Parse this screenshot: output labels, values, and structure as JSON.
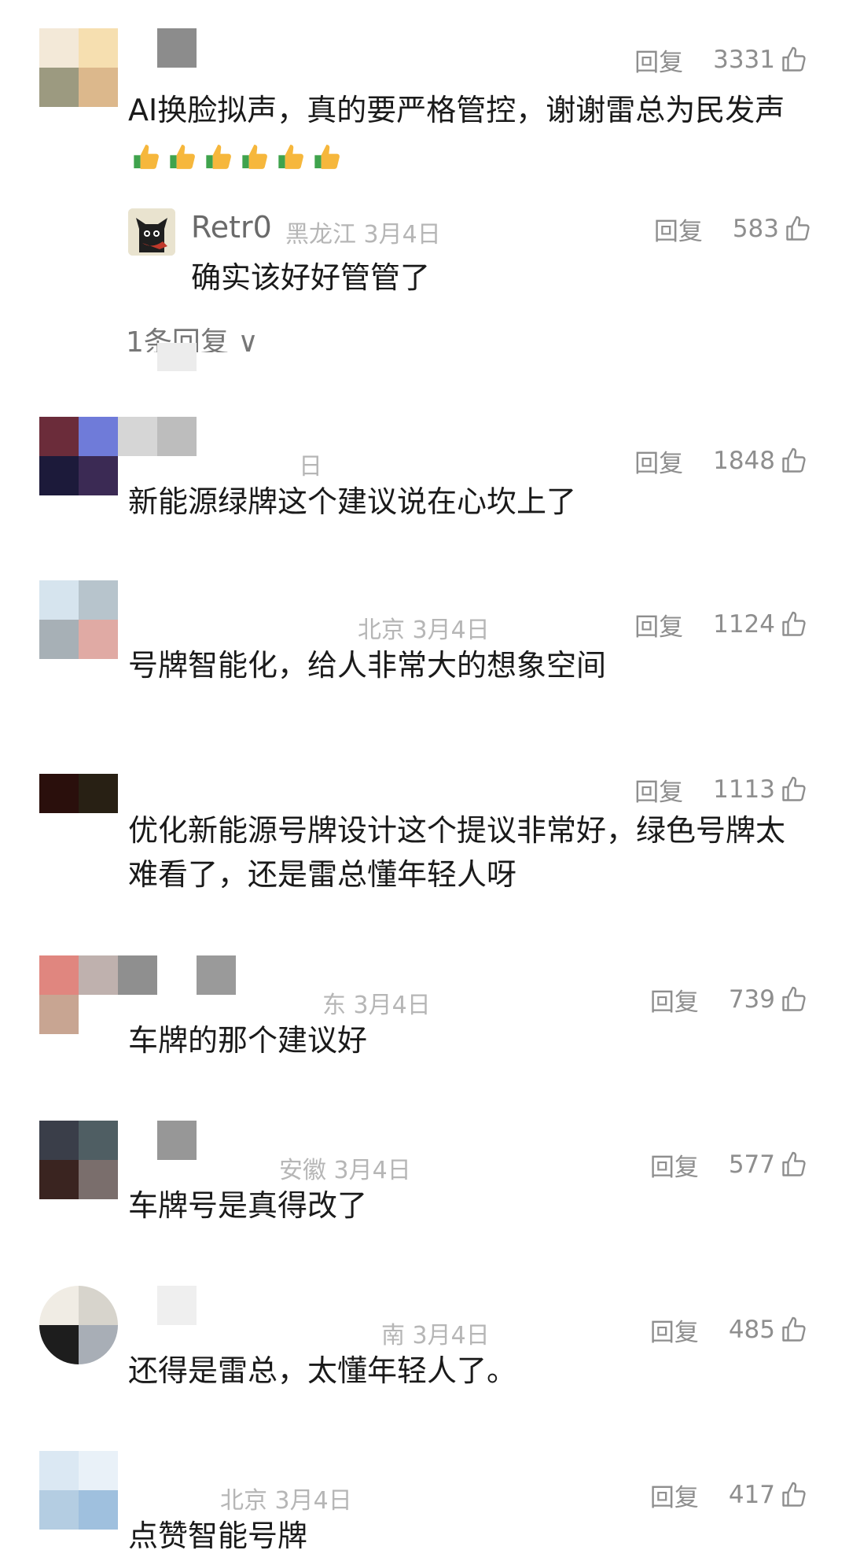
{
  "reply_label": "回复",
  "comments": [
    {
      "meta": "",
      "likes": "3331",
      "text": "AI换脸拟声，真的要严格管控，谢谢雷总为民发声",
      "emoji_count": 6
    },
    {
      "meta": "日",
      "likes": "1848",
      "text": "新能源绿牌这个建议说在心坎上了"
    },
    {
      "meta": "北京  3月4日",
      "likes": "1124",
      "text": "号牌智能化，给人非常大的想象空间"
    },
    {
      "meta": "",
      "likes": "1113",
      "text": "优化新能源号牌设计这个提议非常好，绿色号牌太难看了，还是雷总懂年轻人呀"
    },
    {
      "meta": "东  3月4日",
      "likes": "739",
      "text": "车牌的那个建议好"
    },
    {
      "meta": "安徽  3月4日",
      "likes": "577",
      "text": "车牌号是真得改了"
    },
    {
      "meta": "南  3月4日",
      "likes": "485",
      "text": "还得是雷总，太懂年轻人了。"
    },
    {
      "meta": "北京  3月4日",
      "likes": "417",
      "text": "点赞智能号牌"
    }
  ],
  "sub_reply": {
    "name": "Retr0",
    "meta": "黑龙江  3月4日",
    "likes": "583",
    "text": "确实该好好管管了"
  },
  "more_replies": "1条回复 ∨",
  "icons": {
    "like": "thumbs-up-outline-icon",
    "emoji": "thumbs-up-emoji-icon"
  },
  "colors": {
    "text": "#1a1a1a",
    "meta": "#b6b6b6",
    "action": "#8e8e8e",
    "emoji": "#f6b73c"
  }
}
